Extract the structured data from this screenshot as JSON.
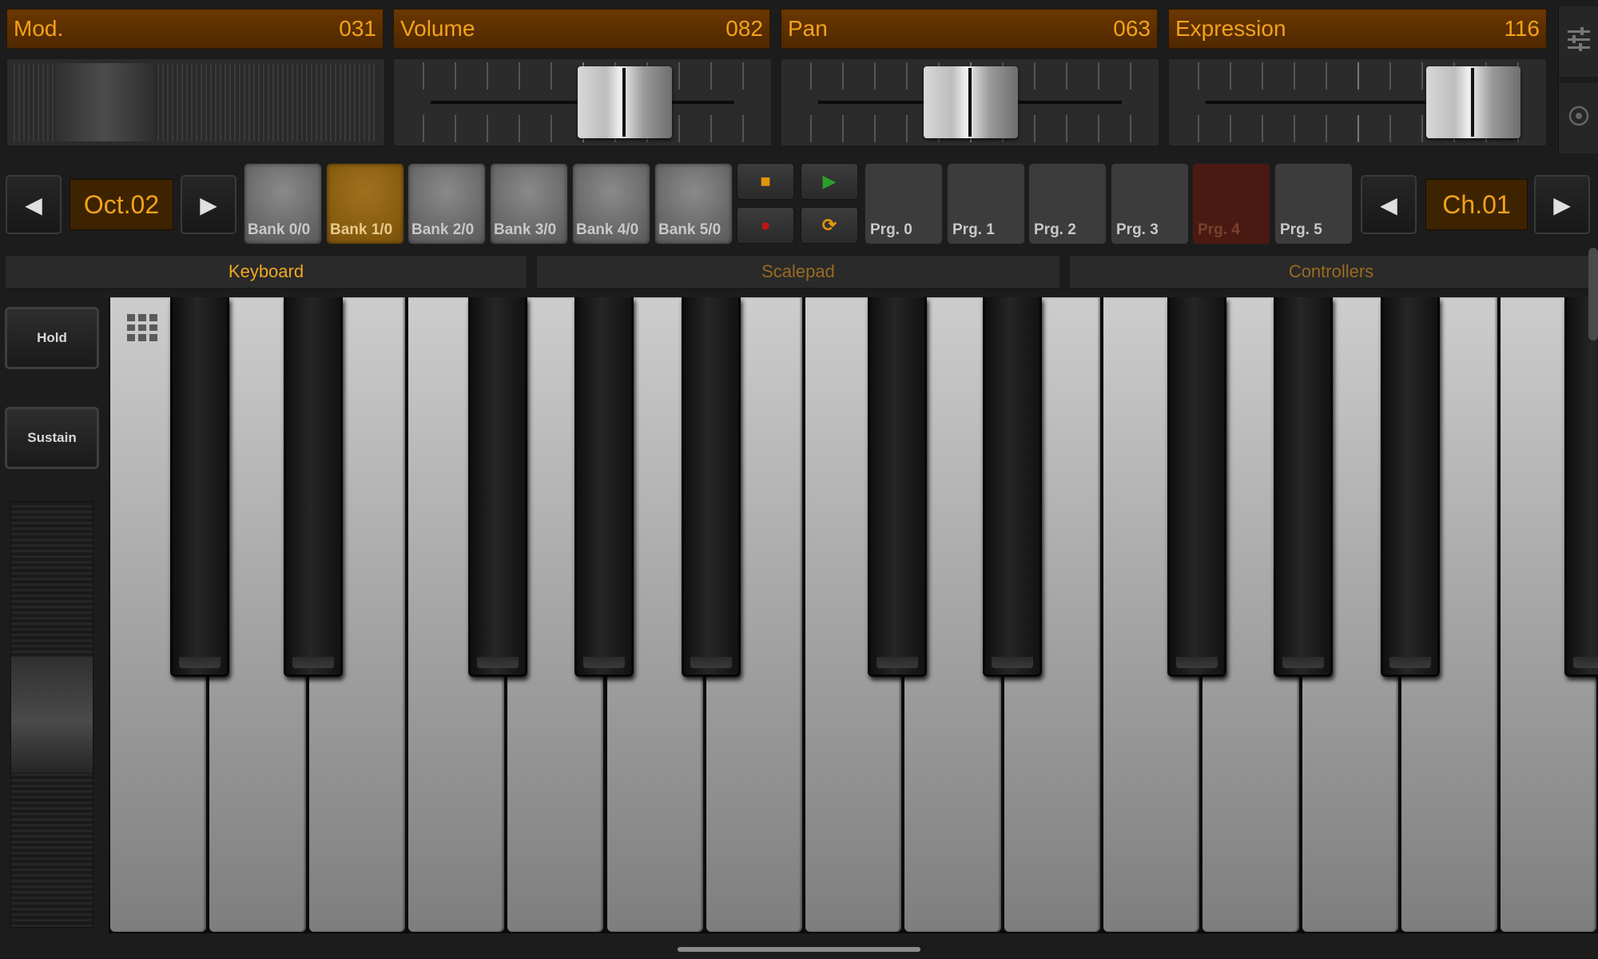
{
  "controllers": [
    {
      "label": "Mod.",
      "value": "031"
    },
    {
      "label": "Volume",
      "value": "082"
    },
    {
      "label": "Pan",
      "value": "063"
    },
    {
      "label": "Expression",
      "value": "116"
    }
  ],
  "octave": {
    "value": "Oct.02"
  },
  "channel": {
    "value": "Ch.01"
  },
  "banks": [
    "Bank 0/0",
    "Bank 1/0",
    "Bank 2/0",
    "Bank 3/0",
    "Bank 4/0",
    "Bank 5/0"
  ],
  "programs": [
    "Prg. 0",
    "Prg. 1",
    "Prg. 2",
    "Prg. 3",
    "Prg. 4",
    "Prg. 5"
  ],
  "tabs": [
    "Keyboard",
    "Scalepad",
    "Controllers"
  ],
  "toggles": {
    "hold": "Hold",
    "sustain": "Sustain"
  },
  "icons": {
    "prev": "◀",
    "next": "▶",
    "stop": "■",
    "play": "▶",
    "record": "●",
    "loop": "⟳",
    "settings": "sliders-icon",
    "circle": "target-icon",
    "grid": "grid-icon"
  },
  "colors": {
    "accent": "#f2a21b",
    "play": "#2aa02a",
    "record": "#c01515",
    "stop": "#e0960a"
  }
}
